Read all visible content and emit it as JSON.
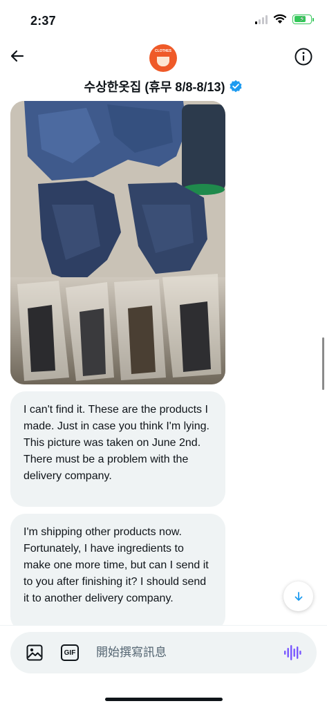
{
  "status_bar": {
    "time": "2:37"
  },
  "header": {
    "title": "수상한옷집 (휴무 8/8-8/13)",
    "verified": true,
    "avatar_text": "CLOTHES"
  },
  "messages": [
    {
      "type": "image",
      "description_icon": "photo-attachment"
    },
    {
      "type": "text",
      "text": "I can't find it. These are the products I made. Just in case you think I'm lying. This picture was taken on June 2nd. There must be a problem with the delivery company."
    },
    {
      "type": "text",
      "text": "I'm shipping other products now. Fortunately, I have ingredients to make one more time, but can I send it to you after finishing it? I should send it to another delivery company."
    }
  ],
  "composer": {
    "placeholder": "開始撰寫訊息",
    "gif_label": "GIF"
  },
  "colors": {
    "accent": "#1d9bf0",
    "bubble": "#eff3f4",
    "voice": "#7856ff",
    "avatar": "#ef5a28"
  }
}
